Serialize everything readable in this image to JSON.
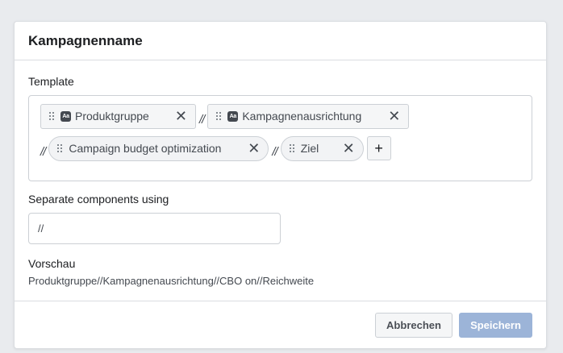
{
  "dialog": {
    "title": "Kampagnenname",
    "template_label": "Template",
    "row1": [
      {
        "label": "Produktgruppe",
        "icon": "ab-icon",
        "style": "rect"
      },
      {
        "label": "Kampagnenausrichtung",
        "icon": "ab-icon",
        "style": "rect"
      }
    ],
    "row2": [
      {
        "label": "Campaign budget optimization",
        "style": "pill"
      },
      {
        "label": "Ziel",
        "style": "pill"
      }
    ],
    "separator": "//",
    "close_glyph": "✕",
    "add_glyph": "+",
    "ab_glyph": "Aa",
    "separate_label": "Separate components using",
    "separate_value": "//",
    "preview_label": "Vorschau",
    "preview_value": "Produktgruppe//Kampagnenausrichtung//CBO on//Reichweite",
    "cancel_label": "Abbrechen",
    "save_label": "Speichern"
  },
  "colors": {
    "background": "#e9ebee",
    "save_disabled": "#9cb4d8",
    "border": "#ccd0d5"
  }
}
